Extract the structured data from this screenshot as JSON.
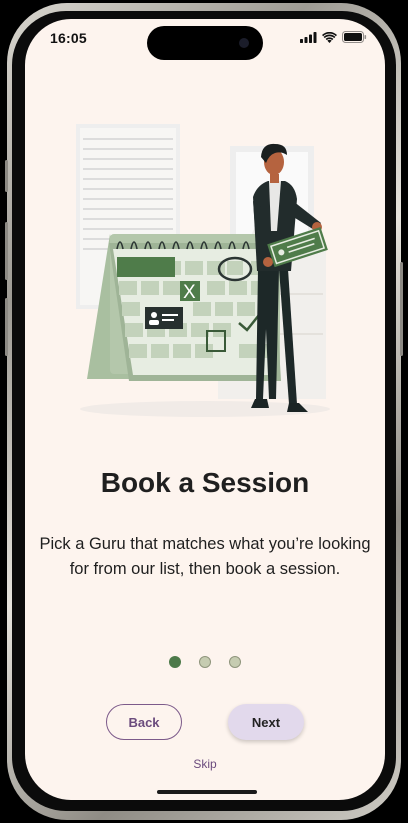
{
  "status_bar": {
    "time": "16:05",
    "icons": [
      "signal-icon",
      "wifi-icon",
      "battery-icon"
    ]
  },
  "onboarding": {
    "title": "Book a Session",
    "description": "Pick a Guru that matches what you’re looking for from our list, then book a session.",
    "illustration": "calendar-booking-illustration",
    "calendar_mark": "X",
    "current_step": 1,
    "total_steps": 3
  },
  "actions": {
    "back_label": "Back",
    "next_label": "Next",
    "skip_label": "Skip"
  },
  "colors": {
    "background": "#fdf4ee",
    "accent_green": "#4d7a4a",
    "inactive_dot": "#c6ccb1",
    "accent_purple": "#6b4b7d",
    "next_button_bg": "#e2d9ec"
  }
}
